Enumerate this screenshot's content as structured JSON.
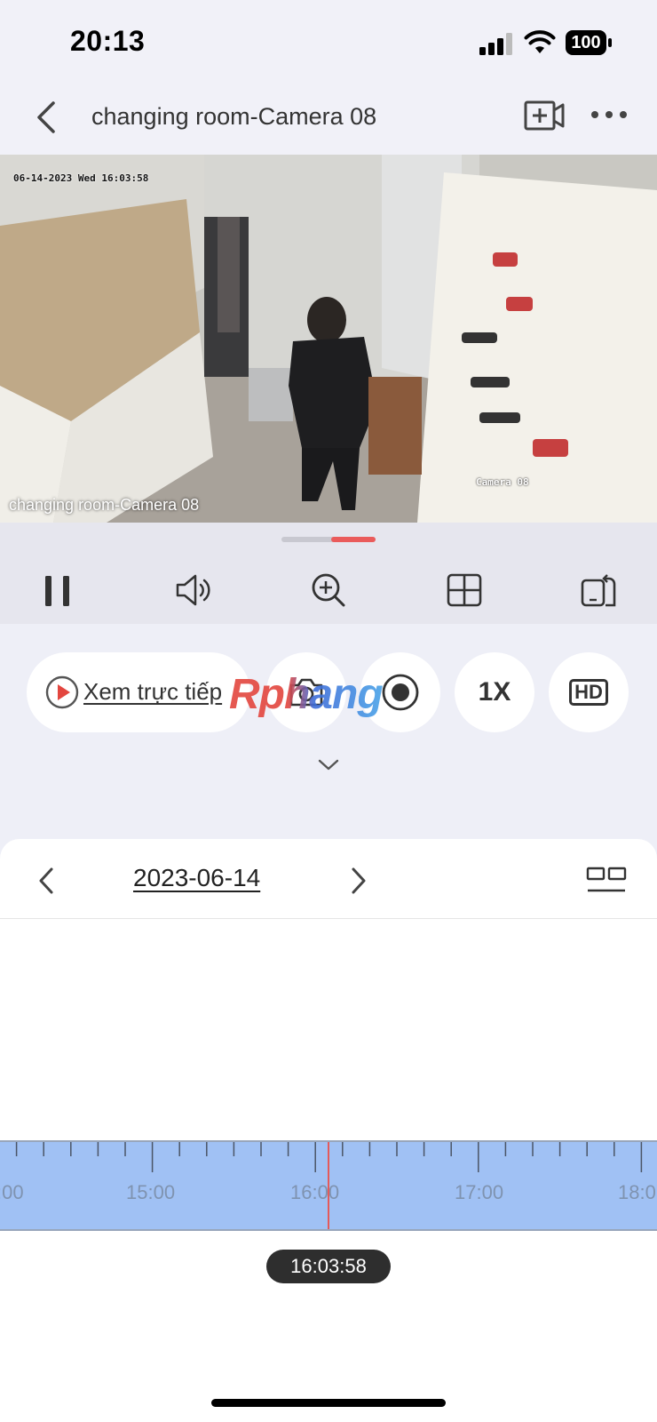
{
  "status_bar": {
    "time": "20:13",
    "battery": "100"
  },
  "header": {
    "title": "changing room-Camera 08"
  },
  "video": {
    "osd_timestamp": "06-14-2023 Wed 16:03:58",
    "osd_camera": "Camera 08",
    "caption": "changing room-Camera 08"
  },
  "playback": {
    "progress_fraction": 0.5,
    "tools": [
      "pause-icon",
      "volume-icon",
      "zoom-in-icon",
      "grid-layout-icon",
      "rotate-screen-icon"
    ]
  },
  "controls": {
    "live_label": "Xem trực tiếp",
    "speed_label": "1X",
    "quality_label": "HD",
    "watermark": "Rphang"
  },
  "timeline": {
    "date": "2023-06-14",
    "labels": [
      ":00",
      "15:00",
      "16:00",
      "17:00",
      "18:0"
    ],
    "current_time": "16:03:58",
    "accent_color": "#e45a5a",
    "bar_color": "#a0c1f4"
  }
}
